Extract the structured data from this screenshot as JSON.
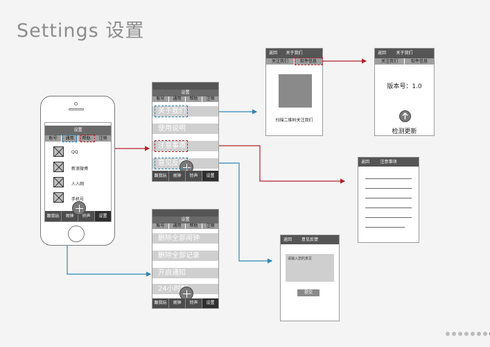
{
  "page": {
    "title": "Settings 设置"
  },
  "phone": {
    "header": "设置",
    "tabs": [
      "账号",
      "通用",
      "帮助",
      "注销"
    ],
    "accounts": [
      "QQ",
      "新浪微博",
      "人人网",
      "手机号"
    ],
    "bottom": [
      "跟我玩",
      "闹钟",
      "铃声",
      "设置"
    ]
  },
  "help_screen": {
    "header": "设置",
    "tabs": [
      "账号",
      "通用",
      "帮助",
      "注销"
    ],
    "items": [
      "关于我们",
      "使用说明",
      "注意事项",
      "意见反馈"
    ],
    "bottom": [
      "跟我玩",
      "闹钟",
      "铃声",
      "设置"
    ]
  },
  "general_screen": {
    "header": "设置",
    "tabs": [
      "账号",
      "通用",
      "帮助",
      "注销"
    ],
    "items": [
      "删除全部闹钟",
      "删除全部记录",
      "开启通知",
      "24小时制"
    ],
    "bottom": [
      "跟我玩",
      "闹钟",
      "铃声",
      "设置"
    ]
  },
  "about_screen": {
    "back": "返回",
    "header": "关于我们",
    "tabs": [
      "关注我们",
      "软件信息"
    ],
    "caption": "扫描二维码关注我们"
  },
  "software_screen": {
    "back": "返回",
    "header": "关于我们",
    "tabs": [
      "关注我们",
      "软件信息"
    ],
    "version": "版本号：1.0",
    "update": "检测更新"
  },
  "notes_screen": {
    "back": "返回",
    "header": "注意事项"
  },
  "feedback_screen": {
    "back": "返回",
    "header": "意见反馈",
    "placeholder": "请输入您的意见",
    "submit": "提交"
  },
  "colors": {
    "red_link": "#b0232a",
    "blue_link": "#2a86b5"
  },
  "pagination": {
    "count": 8,
    "active": 8
  }
}
